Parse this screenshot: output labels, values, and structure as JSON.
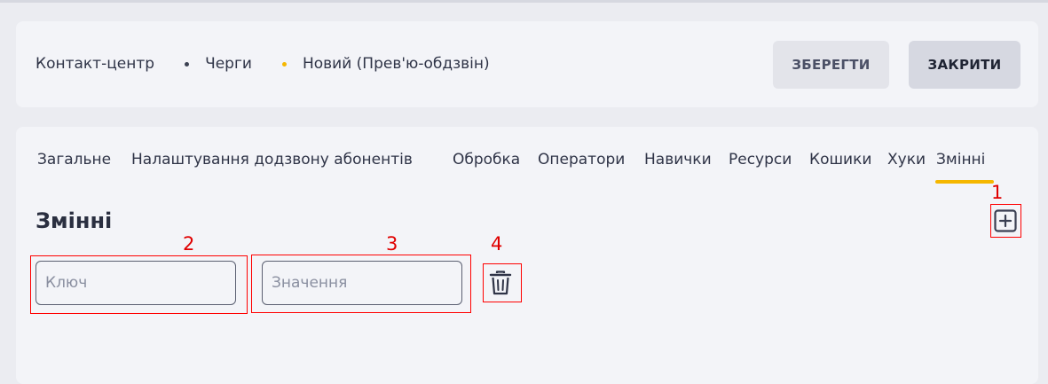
{
  "breadcrumb": [
    "Контакт-центр",
    "Черги",
    "Новий (Прев'ю-обдзвін)"
  ],
  "buttons": {
    "save": "ЗБЕРЕГТИ",
    "close": "ЗАКРИТИ"
  },
  "tabs": [
    "Загальне",
    "Налаштування додзвону абонентів",
    "Обробка",
    "Оператори",
    "Навички",
    "Ресурси",
    "Кошики",
    "Хуки",
    "Змінні"
  ],
  "active_tab": "Змінні",
  "section": {
    "title": "Змінні"
  },
  "fields": {
    "key_placeholder": "Ключ",
    "value_placeholder": "Значення"
  },
  "annotations": [
    "1",
    "2",
    "3",
    "4"
  ],
  "icons": {
    "add": "plus-square-icon",
    "delete": "trash-icon"
  },
  "colors": {
    "accent": "#f5b700",
    "annotation": "#ff0000"
  }
}
